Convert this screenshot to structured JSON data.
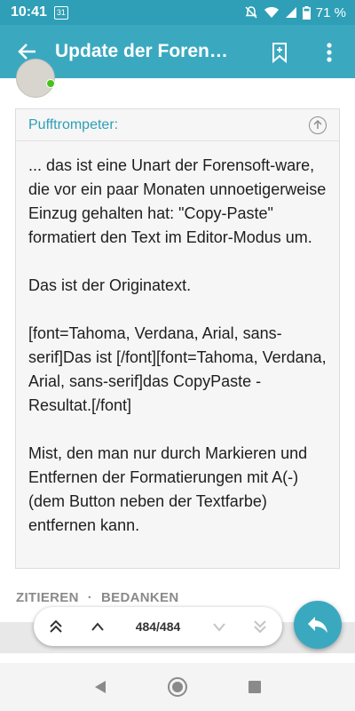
{
  "status_bar": {
    "time": "10:41",
    "calendar_day": "31",
    "battery": "71 %"
  },
  "app_bar": {
    "title": "Update der Foren…"
  },
  "quote": {
    "author": "Pufftrompeter:",
    "paragraphs": [
      "... das ist eine Unart der Forensoft-ware, die vor ein paar Monaten unnoetigerweise Einzug gehalten hat: \"Copy-Paste\" formatiert den Text im Editor-Modus um.",
      "Das ist der Originatext.",
      "[font=Tahoma, Verdana, Arial, sans-serif]Das ist [/font][font=Tahoma, Verdana, Arial, sans-serif]das CopyPaste - Resultat.[/font]",
      "Mist, den man nur durch Markieren und Entfernen der Formatierungen mit A(-) (dem Button neben der Textfarbe) entfernen kann."
    ]
  },
  "actions": {
    "quote_label": "ZITIEREN",
    "separator": "·",
    "thank_label": "BEDANKEN"
  },
  "pager": {
    "count": "484/484"
  },
  "colors": {
    "accent": "#3aa9c0",
    "status_bar": "#2e9fb6",
    "author": "#2e9fb6"
  }
}
